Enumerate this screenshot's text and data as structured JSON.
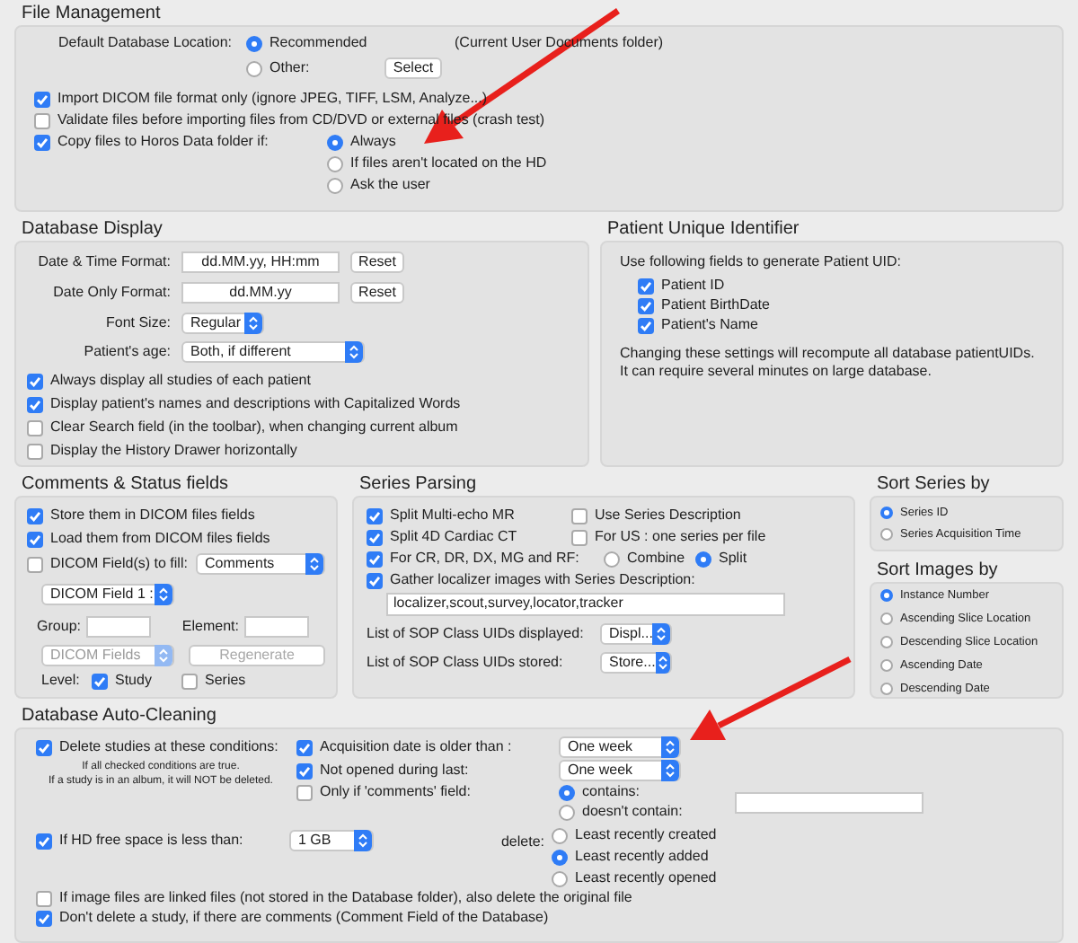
{
  "file_management": {
    "title": "File Management",
    "location_label": "Default Database Location:",
    "location_options": [
      {
        "label": "Recommended",
        "selected": true
      },
      {
        "label": "Other:",
        "selected": false
      }
    ],
    "location_note": "(Current User Documents folder)",
    "select_button": "Select",
    "checkboxes": [
      {
        "label": "Import DICOM file format only (ignore JPEG, TIFF, LSM, Analyze...)",
        "checked": true
      },
      {
        "label": "Validate files before importing files from CD/DVD or external files (crash test)",
        "checked": false
      },
      {
        "label": "Copy files to Horos Data folder if:",
        "checked": true
      }
    ],
    "copy_options": [
      {
        "label": "Always",
        "selected": true
      },
      {
        "label": "If files aren't located on the HD",
        "selected": false
      },
      {
        "label": "Ask the user",
        "selected": false
      }
    ]
  },
  "database_display": {
    "title": "Database Display",
    "formats": [
      {
        "label": "Date & Time Format:",
        "value": "dd.MM.yy, HH:mm",
        "button": "Reset"
      },
      {
        "label": "Date Only Format:",
        "value": "dd.MM.yy",
        "button": "Reset"
      }
    ],
    "font_size": {
      "label": "Font Size:",
      "value": "Regular"
    },
    "patient_age": {
      "label": "Patient's age:",
      "value": "Both, if different"
    },
    "checkboxes": [
      {
        "label": "Always display all studies of each patient",
        "checked": true
      },
      {
        "label": "Display patient's names and descriptions with Capitalized Words",
        "checked": true
      },
      {
        "label": "Clear Search field (in the toolbar), when changing current album",
        "checked": false
      },
      {
        "label": "Display the History Drawer horizontally",
        "checked": false
      }
    ]
  },
  "patient_uid": {
    "title": "Patient Unique Identifier",
    "intro": "Use following fields to generate Patient UID:",
    "checkboxes": [
      {
        "label": "Patient ID",
        "checked": true
      },
      {
        "label": "Patient BirthDate",
        "checked": true
      },
      {
        "label": "Patient's Name",
        "checked": true
      }
    ],
    "note_lines": [
      "Changing these settings will recompute all database patientUIDs.",
      "It can require several minutes on large database."
    ]
  },
  "comments_status": {
    "title": "Comments & Status fields",
    "checkboxes": [
      {
        "label": "Store them in DICOM files fields",
        "checked": true
      },
      {
        "label": "Load them from DICOM files fields",
        "checked": true
      }
    ],
    "fill": {
      "label": "DICOM Field(s) to fill:",
      "checked": false,
      "value": "Comments"
    },
    "field_popup": {
      "value": "DICOM Field 1 :",
      "disabled": false
    },
    "group_label": "Group:",
    "element_label": "Element:",
    "fields_popup": {
      "value": "DICOM Fields",
      "disabled": true
    },
    "regenerate": {
      "label": "Regenerate",
      "disabled": true
    },
    "level_label": "Level:",
    "levels": [
      {
        "label": "Study",
        "checked": true
      },
      {
        "label": "Series",
        "checked": false
      }
    ]
  },
  "series_parsing": {
    "title": "Series Parsing",
    "options": [
      {
        "label": "Split Multi-echo MR",
        "checked": true
      },
      {
        "label": "Use Series Description",
        "checked": false
      },
      {
        "label": "Split 4D Cardiac CT",
        "checked": true
      },
      {
        "label": "For US : one series per file",
        "checked": false
      }
    ],
    "cr": {
      "label": "For CR, DR, DX, MG and RF:",
      "checked": true,
      "choices": [
        {
          "label": "Combine",
          "selected": false
        },
        {
          "label": "Split",
          "selected": true
        }
      ]
    },
    "gather": {
      "label": "Gather localizer images with Series Description:",
      "checked": true,
      "value": "localizer,scout,survey,locator,tracker"
    },
    "sop": [
      {
        "label": "List of SOP Class UIDs displayed:",
        "value": "Displ..."
      },
      {
        "label": "List of SOP Class UIDs stored:",
        "value": "Store..."
      }
    ]
  },
  "sort_series": {
    "title": "Sort Series by",
    "options": [
      {
        "label": "Series ID",
        "selected": true
      },
      {
        "label": "Series Acquisition Time",
        "selected": false
      }
    ]
  },
  "sort_images": {
    "title": "Sort Images by",
    "options": [
      {
        "label": "Instance Number",
        "selected": true
      },
      {
        "label": "Ascending Slice Location",
        "selected": false
      },
      {
        "label": "Descending Slice Location",
        "selected": false
      },
      {
        "label": "Ascending Date",
        "selected": false
      },
      {
        "label": "Descending Date",
        "selected": false
      }
    ]
  },
  "auto_cleaning": {
    "title": "Database Auto-Cleaning",
    "delete": {
      "label": "Delete studies at these conditions:",
      "checked": true
    },
    "note_lines": [
      "If all checked conditions are true.",
      "If a study is in an album, it will NOT be deleted."
    ],
    "conditions": [
      {
        "label": "Acquisition date is older than :",
        "checked": true,
        "value": "One week"
      },
      {
        "label": "Not opened during last:",
        "checked": true,
        "value": "One week"
      },
      {
        "label": "Only if 'comments' field:",
        "checked": false
      }
    ],
    "match": [
      {
        "label": "contains:",
        "selected": true
      },
      {
        "label": "doesn't contain:",
        "selected": false
      }
    ],
    "hd": {
      "label": "If HD free space is less than:",
      "checked": true,
      "value": "1 GB"
    },
    "delete_label": "delete:",
    "delete_options": [
      {
        "label": "Least recently created",
        "selected": false
      },
      {
        "label": "Least recently added",
        "selected": true
      },
      {
        "label": "Least recently opened",
        "selected": false
      }
    ],
    "checkboxes": [
      {
        "label": "If image files are linked files (not stored in the Database folder), also delete the original file",
        "checked": false
      },
      {
        "label": "Don't delete a study, if there are comments (Comment Field of the Database)",
        "checked": true
      }
    ]
  }
}
